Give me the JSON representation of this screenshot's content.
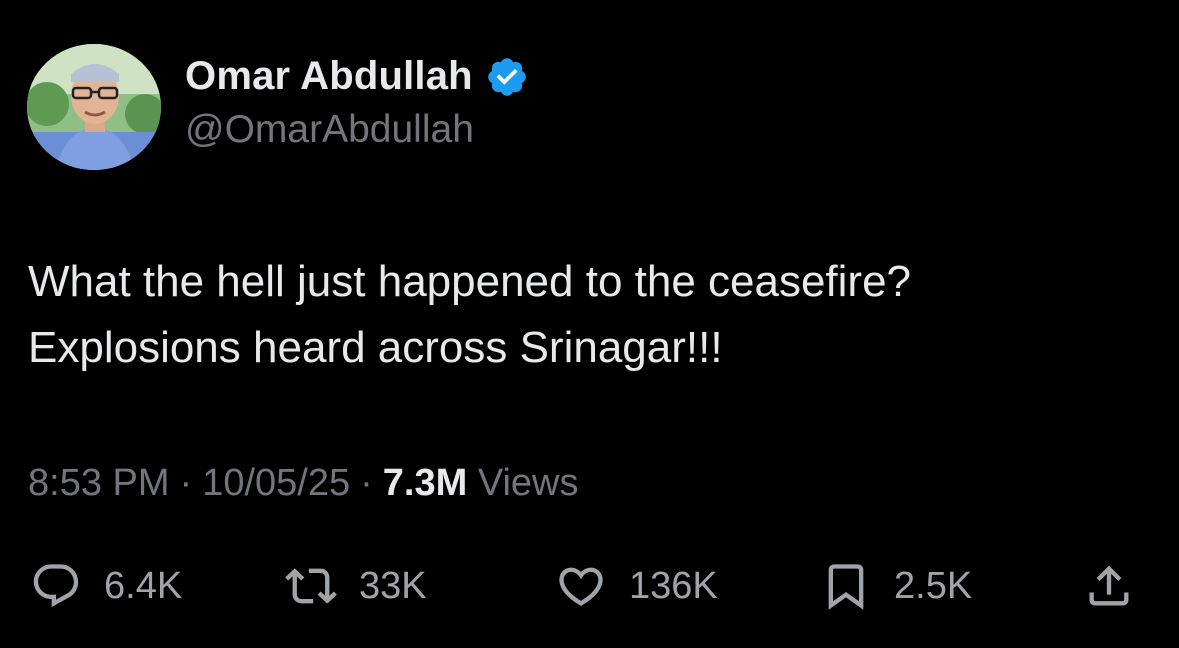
{
  "author": {
    "display_name": "Omar Abdullah",
    "handle": "@OmarAbdullah",
    "verified_badge_color": "#1d9bf0",
    "avatar_icon": "profile-photo"
  },
  "tweet": {
    "lines": [
      "What the hell just happened to the ceasefire?",
      "Explosions heard across Srinagar!!!"
    ]
  },
  "meta": {
    "time": "8:53 PM",
    "separator": "·",
    "date": "10/05/25",
    "views_count": "7.3M",
    "views_label": "Views"
  },
  "actions": {
    "reply": {
      "icon": "reply-icon",
      "count": "6.4K"
    },
    "retweet": {
      "icon": "retweet-icon",
      "count": "33K"
    },
    "like": {
      "icon": "heart-icon",
      "count": "136K"
    },
    "bookmark": {
      "icon": "bookmark-icon",
      "count": "2.5K"
    },
    "share": {
      "icon": "share-icon"
    }
  },
  "colors": {
    "background": "#000000",
    "primary_text": "#e7e9ea",
    "secondary_text": "#71767b"
  }
}
